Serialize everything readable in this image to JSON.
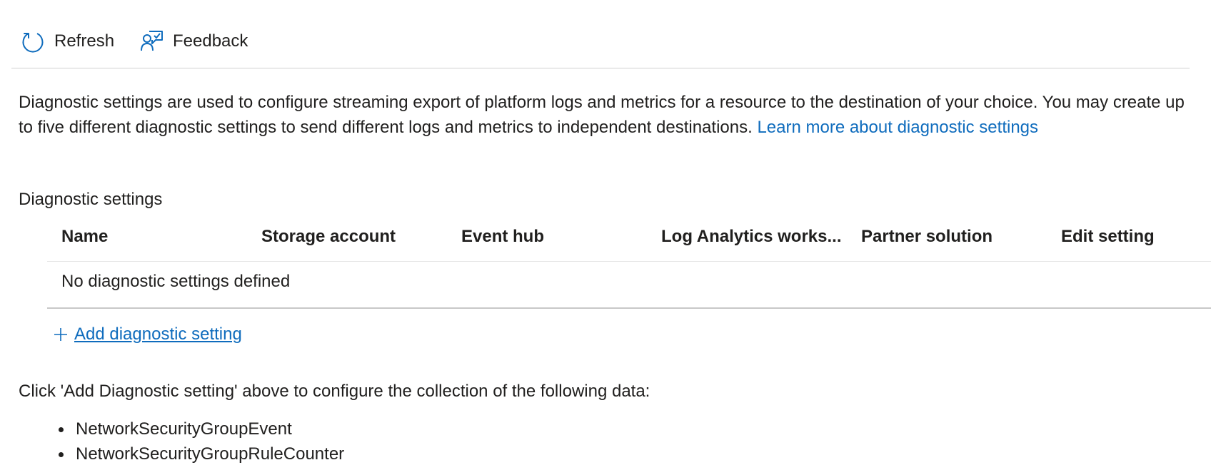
{
  "toolbar": {
    "refresh_label": "Refresh",
    "feedback_label": "Feedback",
    "icon_color": "#0f6cbd"
  },
  "description": {
    "text": "Diagnostic settings are used to configure streaming export of platform logs and metrics for a resource to the destination of your choice. You may create up to five different diagnostic settings to send different logs and metrics to independent destinations. ",
    "link_text": "Learn more about diagnostic settings"
  },
  "section_title": "Diagnostic settings",
  "table": {
    "columns": [
      "Name",
      "Storage account",
      "Event hub",
      "Log Analytics works...",
      "Partner solution",
      "Edit setting"
    ],
    "empty_message": "No diagnostic settings defined"
  },
  "add_link_label": "Add diagnostic setting",
  "info_text": "Click 'Add Diagnostic setting' above to configure the collection of the following data:",
  "data_items": [
    "NetworkSecurityGroupEvent",
    "NetworkSecurityGroupRuleCounter"
  ],
  "colors": {
    "link": "#0f6cbd",
    "text": "#201f1e"
  }
}
